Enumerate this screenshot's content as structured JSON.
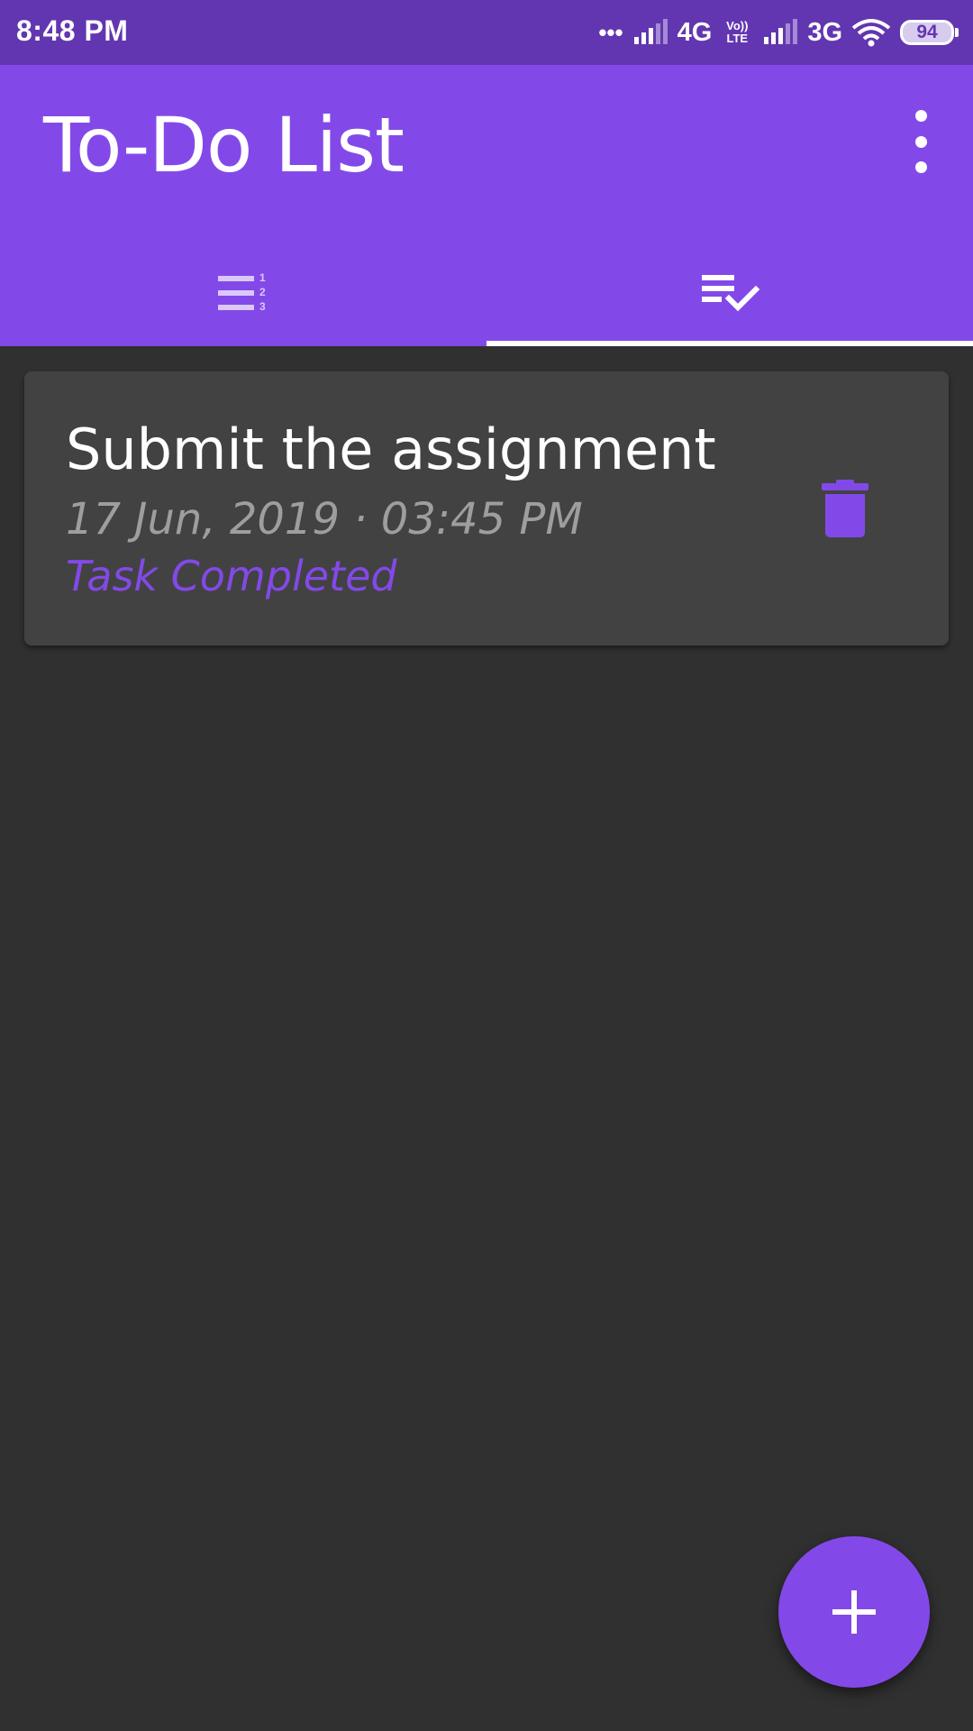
{
  "status_bar": {
    "time": "8:48 PM",
    "dots": "•••",
    "network_1": "4G",
    "volte_top": "Vo))",
    "volte_bottom": "LTE",
    "network_2": "3G",
    "battery": "94"
  },
  "app_bar": {
    "title": "To-Do List",
    "menu_icon": "more-vert-icon"
  },
  "tabs": [
    {
      "icon": "format-list-numbered-icon",
      "selected": false
    },
    {
      "icon": "playlist-check-icon",
      "selected": true
    }
  ],
  "tasks": [
    {
      "title": "Submit the assignment",
      "datetime": "17 Jun, 2019 · 03:45 PM",
      "status": "Task Completed",
      "action_icon": "delete-icon"
    }
  ],
  "fab": {
    "icon": "add-icon"
  },
  "colors": {
    "status_bar": "#6236b0",
    "primary": "#8349e8",
    "background": "#303030",
    "card": "#424242",
    "muted_text": "#9e9e9e"
  }
}
